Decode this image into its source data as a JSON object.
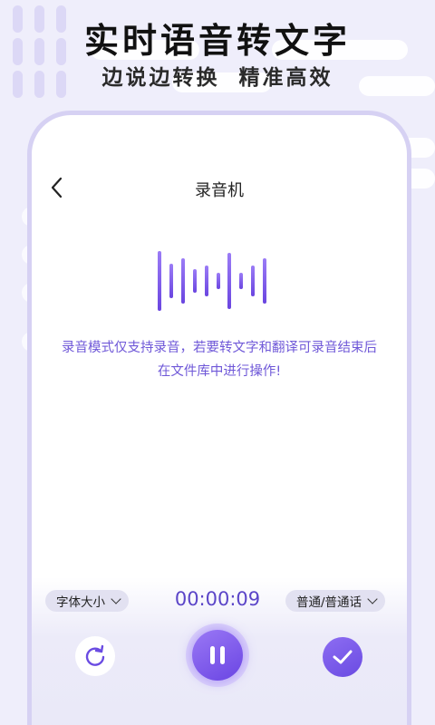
{
  "banner": {
    "headline": "实时语音转文字",
    "subline": "边说边转换  精准高效"
  },
  "nav": {
    "back_icon": "chevron-left-icon",
    "title": "录音机"
  },
  "recording": {
    "waveform_icon": "audio-waveform-icon",
    "notice": "录音模式仅支持录音，若要转文字和翻译可录音结束后在文件库中进行操作!",
    "timer": "00:00:09"
  },
  "controls": {
    "font_size_label": "字体大小",
    "language_label": "普通/普通话",
    "reset_icon": "refresh-icon",
    "pause_icon": "pause-icon",
    "confirm_icon": "check-icon"
  },
  "colors": {
    "accent": "#6f58d8",
    "accent_dark": "#5b45c8",
    "frame": "#d6d1f3",
    "background": "#efeefb"
  }
}
